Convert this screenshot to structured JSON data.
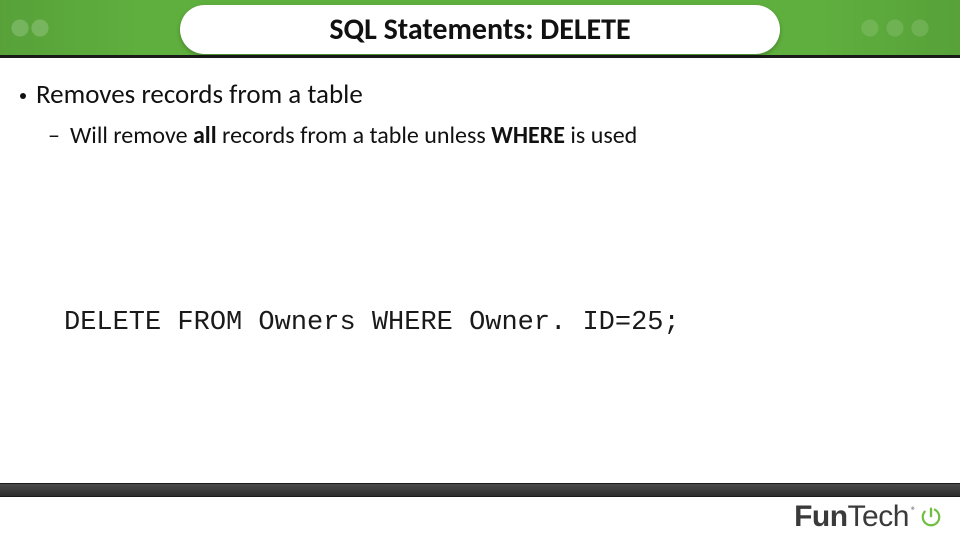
{
  "header": {
    "title": "SQL Statements: DELETE"
  },
  "bullets": {
    "l1_text": "Removes records from a table",
    "l2_prefix": "Will remove ",
    "l2_bold1": "all",
    "l2_mid": " records from a table unless ",
    "l2_bold2": "WHERE",
    "l2_suffix": " is used"
  },
  "code": {
    "line": "DELETE FROM Owners WHERE Owner. ID=25;"
  },
  "brand": {
    "name_part1": "Fun",
    "name_part2": "Tech",
    "registered": "®",
    "accent_color": "#6fbf3f"
  }
}
